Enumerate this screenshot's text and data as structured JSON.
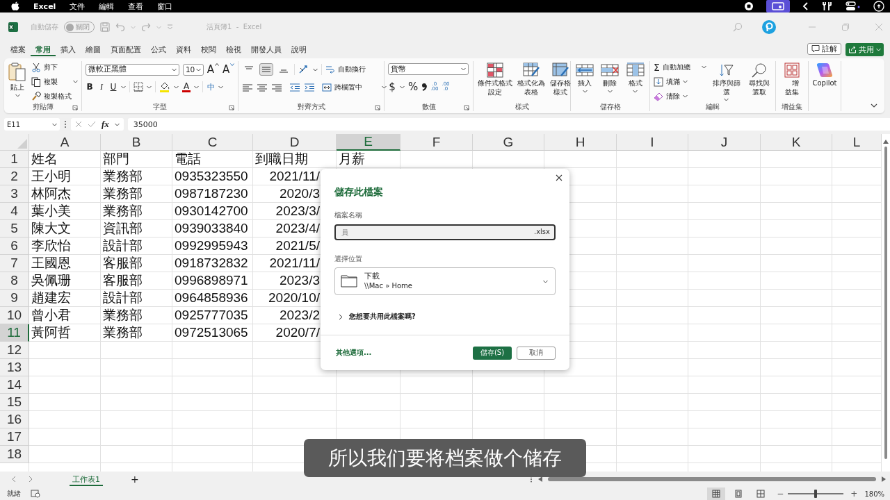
{
  "menubar": {
    "app": "Excel",
    "items": [
      "文件",
      "編輯",
      "查看",
      "窗口"
    ]
  },
  "titlebar": {
    "autosave_label": "自動儲存",
    "autosave": {
      "on": false,
      "label": "關閉"
    },
    "title": "活頁簿1  -  Excel"
  },
  "ribbon_tabs": [
    {
      "label": "檔案",
      "selected": false
    },
    {
      "label": "常用",
      "selected": true
    },
    {
      "label": "插入",
      "selected": false
    },
    {
      "label": "繪圖",
      "selected": false
    },
    {
      "label": "頁面配置",
      "selected": false
    },
    {
      "label": "公式",
      "selected": false
    },
    {
      "label": "資料",
      "selected": false
    },
    {
      "label": "校閱",
      "selected": false
    },
    {
      "label": "檢視",
      "selected": false
    },
    {
      "label": "開發人員",
      "selected": false
    },
    {
      "label": "說明",
      "selected": false
    }
  ],
  "comments_button": "註解",
  "share_button": "共用",
  "ribbon": {
    "clipboard": {
      "label": "剪貼簿",
      "paste": "貼上",
      "cut": "剪下",
      "copy": "複製",
      "format_painter": "複製格式"
    },
    "font": {
      "label": "字型",
      "font": "微軟正黑體",
      "size": "10",
      "grow": "A",
      "shrink": "A",
      "bold": "B",
      "italic": "I",
      "underline": "U",
      "font_color": "A",
      "phonetic": "中"
    },
    "alignment": {
      "label": "對齊方式",
      "vertical_align": [
        {
          "selected": false
        },
        {
          "selected": true
        },
        {
          "selected": false
        }
      ],
      "wrap_text": "自動換行",
      "merge_center": "跨欄置中"
    },
    "number": {
      "label": "數值",
      "format": "貨幣",
      "currency": "$",
      "percent": "%",
      "increase_decimal": [
        ".0",
        ".00"
      ],
      "decrease_decimal": [
        ".00",
        ".0"
      ]
    },
    "styles": {
      "label": "樣式",
      "buttons": [
        "條件式格式設定",
        "格式化為表格",
        "儲存格樣式"
      ]
    },
    "cells": {
      "label": "儲存格",
      "buttons": [
        "插入",
        "刪除",
        "格式"
      ]
    },
    "editing": {
      "label": "編輯",
      "sigma": "Σ",
      "autosum": "自動加總",
      "fill": "填滿",
      "clear": "清除",
      "sort_filter": "排序與篩選",
      "find_select": "尋找與選取"
    },
    "addins": {
      "label": "增益集",
      "button": "增益集"
    },
    "copilot": "Copilot"
  },
  "formula_bar": {
    "name_box": "E11",
    "fx": "fx",
    "formula": "35000"
  },
  "sheet": {
    "columns": [
      {
        "label": "A",
        "selected": false
      },
      {
        "label": "B",
        "selected": false
      },
      {
        "label": "C",
        "selected": false
      },
      {
        "label": "D",
        "selected": false
      },
      {
        "label": "E",
        "selected": true
      },
      {
        "label": "F",
        "selected": false
      },
      {
        "label": "G",
        "selected": false
      },
      {
        "label": "H",
        "selected": false
      },
      {
        "label": "I",
        "selected": false
      },
      {
        "label": "J",
        "selected": false
      },
      {
        "label": "K",
        "selected": false
      },
      {
        "label": "L",
        "selected": false
      }
    ],
    "rows": [
      {
        "label": "1",
        "selected": false,
        "cells": [
          "姓名",
          "部門",
          "電話",
          "到職日期",
          "月薪"
        ]
      },
      {
        "label": "2",
        "selected": false,
        "cells": [
          "王小明",
          "業務部",
          "0935323550",
          "2021/11/"
        ]
      },
      {
        "label": "3",
        "selected": false,
        "cells": [
          "林阿杰",
          "業務部",
          "0987187230",
          "2020/3"
        ]
      },
      {
        "label": "4",
        "selected": false,
        "cells": [
          "葉小美",
          "業務部",
          "0930142700",
          "2023/3/"
        ]
      },
      {
        "label": "5",
        "selected": false,
        "cells": [
          "陳大文",
          "資訊部",
          "0939033840",
          "2023/4/"
        ]
      },
      {
        "label": "6",
        "selected": false,
        "cells": [
          "李欣怡",
          "設計部",
          "0992995943",
          "2021/5/"
        ]
      },
      {
        "label": "7",
        "selected": false,
        "cells": [
          "王國恩",
          "客服部",
          "0918732832",
          "2021/11/"
        ]
      },
      {
        "label": "8",
        "selected": false,
        "cells": [
          "吳佩珊",
          "客服部",
          "0996898971",
          "2023/3"
        ]
      },
      {
        "label": "9",
        "selected": false,
        "cells": [
          "趙建宏",
          "設計部",
          "0964858936",
          "2020/10/"
        ]
      },
      {
        "label": "10",
        "selected": false,
        "cells": [
          "曾小君",
          "業務部",
          "0925777035",
          "2023/2"
        ]
      },
      {
        "label": "11",
        "selected": true,
        "cells": [
          "黃阿哲",
          "業務部",
          "0972513065",
          "2020/7/"
        ]
      },
      {
        "label": "12",
        "selected": false
      },
      {
        "label": "13",
        "selected": false
      },
      {
        "label": "14",
        "selected": false
      },
      {
        "label": "15",
        "selected": false
      },
      {
        "label": "16",
        "selected": false
      },
      {
        "label": "17",
        "selected": false
      },
      {
        "label": "18",
        "selected": false
      }
    ]
  },
  "sheet_tabs": [
    {
      "label": "工作表1",
      "selected": true
    }
  ],
  "add_sheet": "+",
  "status_bar": {
    "status": "就緒",
    "views": [
      {
        "selected": true
      },
      {
        "selected": false
      },
      {
        "selected": false
      }
    ],
    "zoom": {
      "minus": "−",
      "plus": "+",
      "level": 0.5,
      "reading": "180%"
    }
  },
  "dialog": {
    "title": "儲存此檔案",
    "name_label": "檔案名稱",
    "file_name": "員",
    "extension": ".xlsx",
    "location_label": "選擇位置",
    "location": "下載",
    "location_path": "\\\\Mac » Home",
    "share_question": "您想要共用此檔案嗎?",
    "more_options": "其他選項...",
    "save": "儲存(S)",
    "cancel": "取消"
  },
  "subtitle": "所以我们要将档案做个储存"
}
